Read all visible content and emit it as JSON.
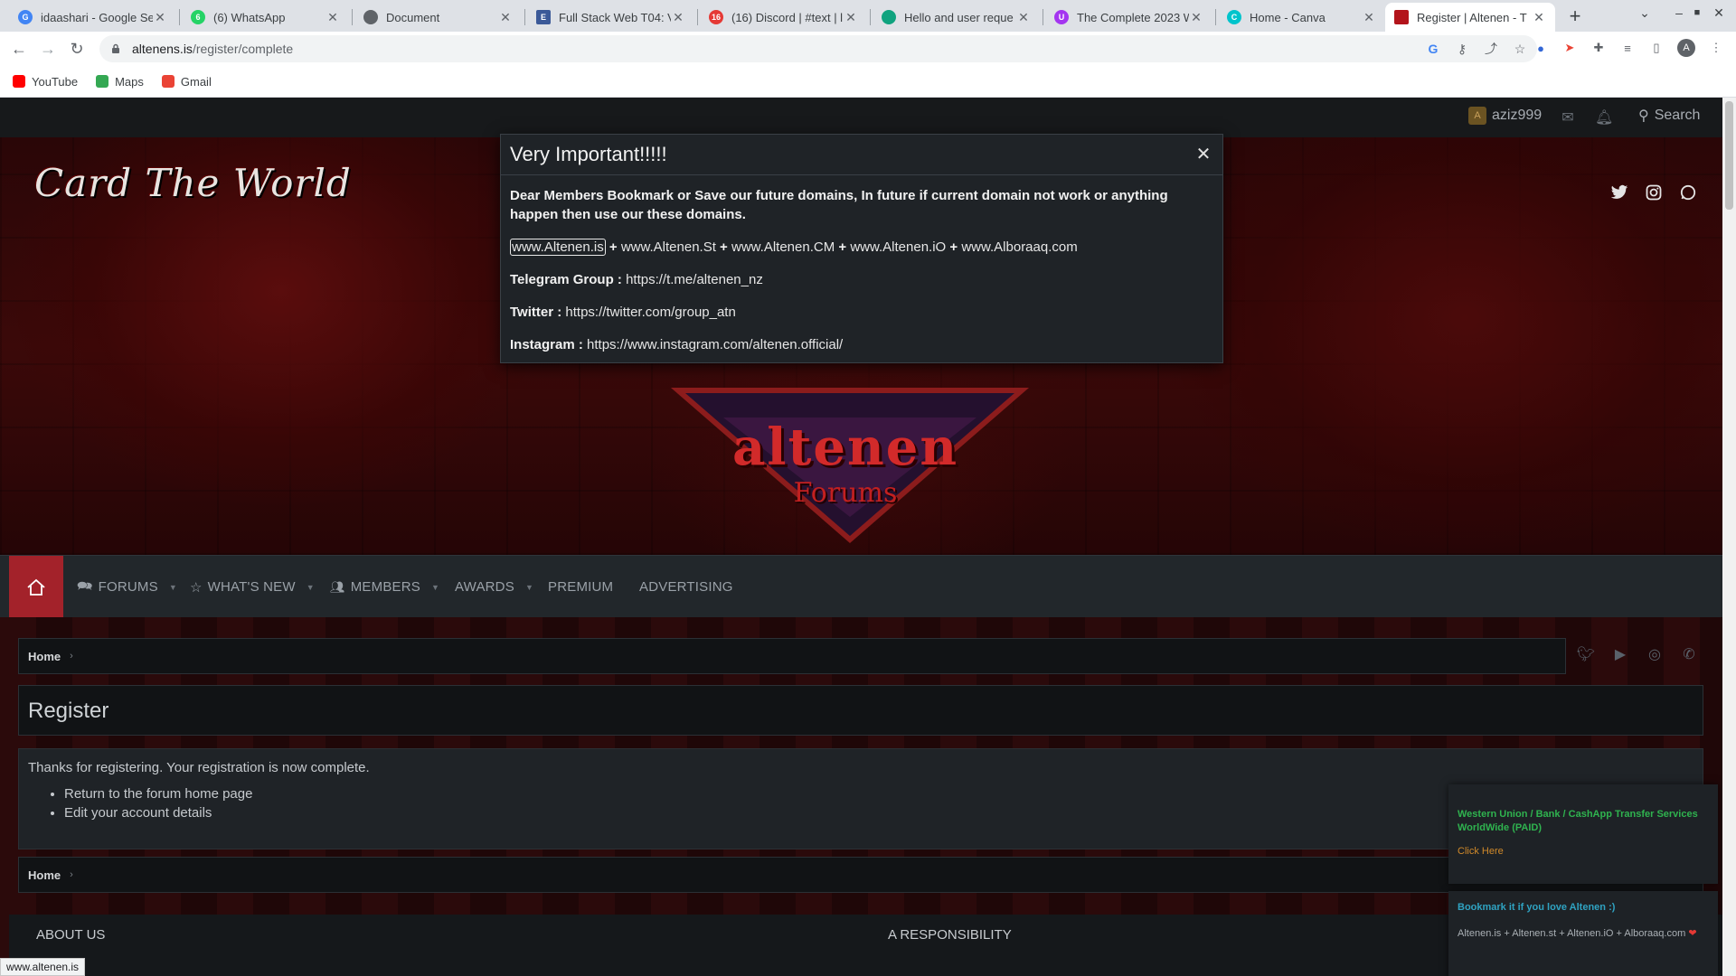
{
  "browser": {
    "tabs": [
      {
        "label": "idaashari - Google Se",
        "icon_letter": "G",
        "color": "#4285f4"
      },
      {
        "label": "(6) WhatsApp",
        "icon_letter": "6",
        "color": "#25d366"
      },
      {
        "label": "Document",
        "icon_letter": "",
        "color": "#5f6368"
      },
      {
        "label": "Full Stack Web T04: V",
        "icon_letter": "E",
        "color": "#3b5998"
      },
      {
        "label": "(16) Discord | #text | l",
        "icon_letter": "16",
        "color": "#e53935"
      },
      {
        "label": "Hello and user reque",
        "icon_letter": "",
        "color": "#10a37f"
      },
      {
        "label": "The Complete 2023 W",
        "icon_letter": "U",
        "color": "#a435f0"
      },
      {
        "label": "Home - Canva",
        "icon_letter": "C",
        "color": "#00c4cc"
      },
      {
        "label": "Register | Altenen - T",
        "icon_letter": "",
        "color": "#b3141b"
      }
    ],
    "url_host": "altenens.is",
    "url_path": "/register/complete",
    "avatar_letter": "A",
    "bookmarks": [
      {
        "label": "YouTube",
        "color": "#ff0000"
      },
      {
        "label": "Maps",
        "color": "#34a853"
      },
      {
        "label": "Gmail",
        "color": "#ea4335"
      }
    ],
    "status_url": "www.altenen.is"
  },
  "topbar": {
    "user_avatar_letter": "A",
    "username": "aziz999",
    "search_label": "Search"
  },
  "banner": {
    "site_title": "Card The World",
    "logo_text": "altenen",
    "logo_sub": "Forums"
  },
  "nav": {
    "items": [
      {
        "label": "Forums",
        "icon": "forums-icon"
      },
      {
        "label": "What's new",
        "icon": "star-icon"
      },
      {
        "label": "Members",
        "icon": "members-icon"
      },
      {
        "label": "Awards"
      },
      {
        "label": "Premium"
      },
      {
        "label": "Advertising"
      }
    ]
  },
  "breadcrumb": {
    "home": "Home"
  },
  "page": {
    "title": "Register",
    "message": "Thanks for registering. Your registration is now complete.",
    "links": [
      "Return to the forum home page",
      "Edit your account details"
    ]
  },
  "footer": {
    "about": "About us",
    "responsibility": "A Responsibility"
  },
  "promos": {
    "transfer_title": "Western Union / Bank / CashApp Transfer Services WorldWide (PAID)",
    "transfer_link": "Click Here",
    "bookmark_title": "Bookmark it if you love Altenen :)",
    "bookmark_domains": "Altenen.is + Altenen.st + Altenen.iO + Alboraaq.com"
  },
  "modal": {
    "title": "Very Important!!!!!",
    "warning": "Dear Members Bookmark or Save our future domains, In future if current domain not work or anything happen then use our these domains.",
    "domains": [
      "www.Altenen.is",
      "www.Altenen.St",
      "www.Altenen.CM",
      "www.Altenen.iO",
      "www.Alboraaq.com"
    ],
    "telegram_label": "Telegram Group :",
    "telegram_url": "https://t.me/altenen_nz",
    "twitter_label": "Twitter :",
    "twitter_url": "https://twitter.com/group_atn",
    "instagram_label": "Instagram :",
    "instagram_url": "https://www.instagram.com/altenen.official/"
  },
  "colors": {
    "accent_red": "#a3222a",
    "promo_green": "#2fb34f",
    "promo_orange": "#d18a2a",
    "promo_blue": "#2fa3c2"
  }
}
